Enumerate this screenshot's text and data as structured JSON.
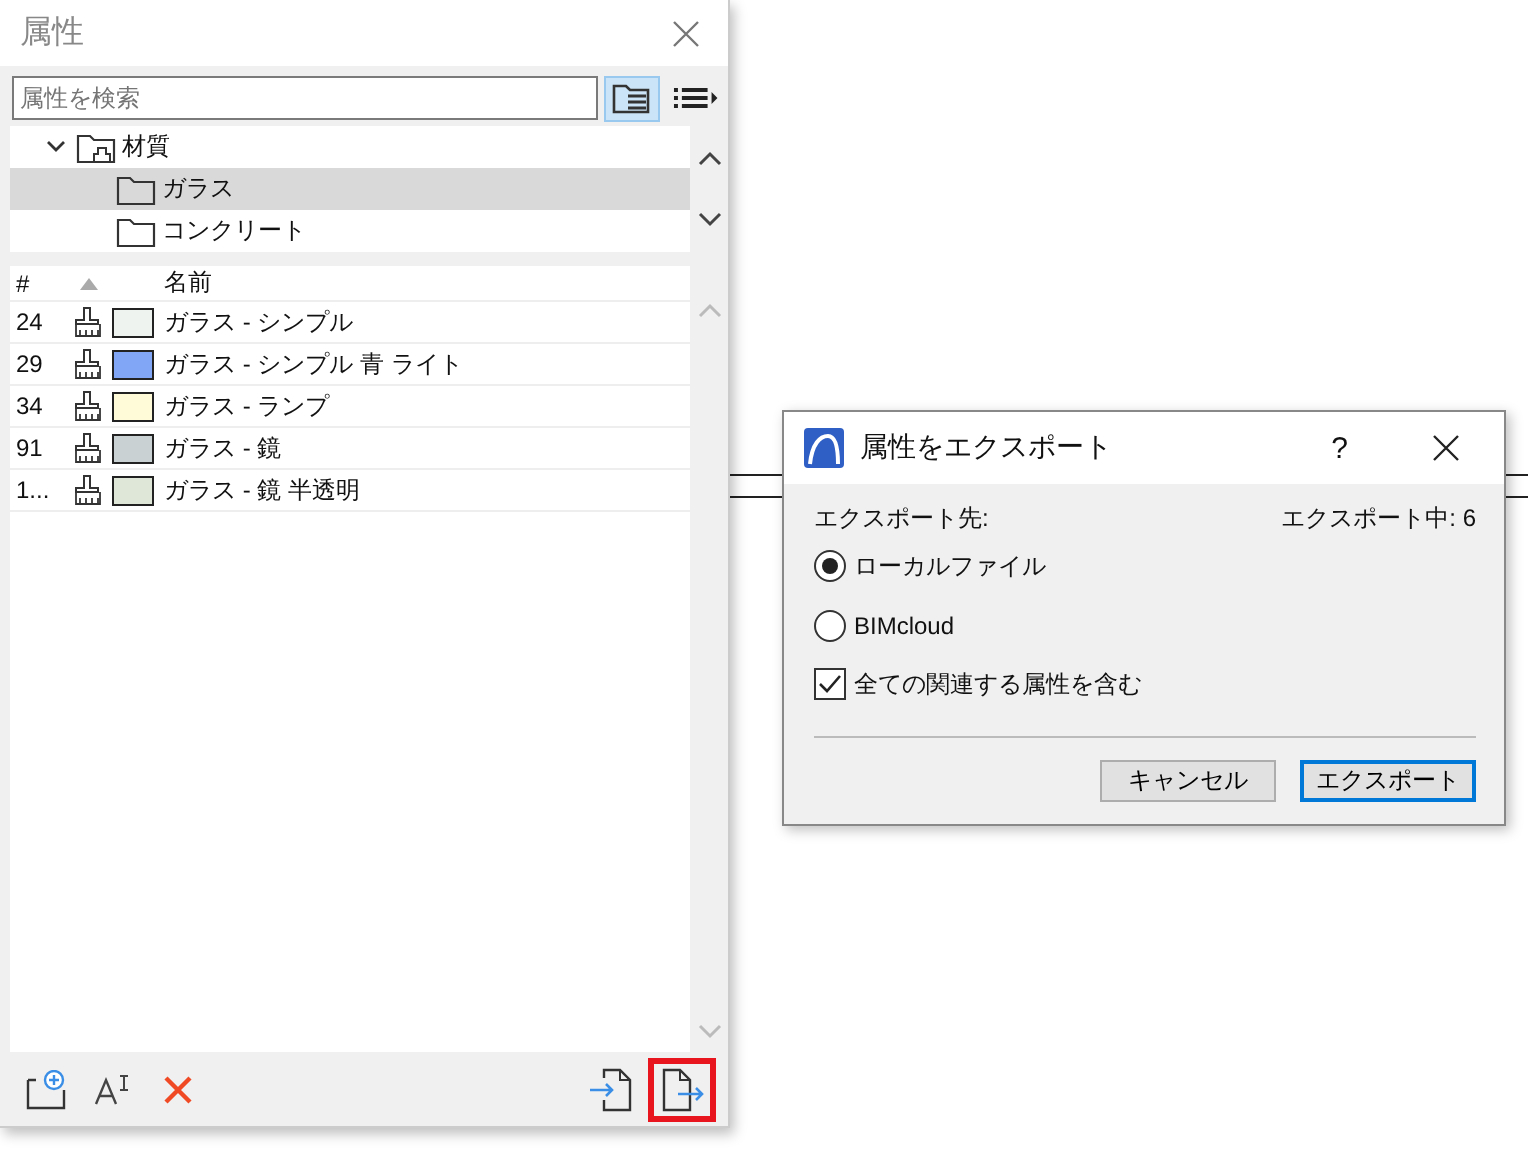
{
  "panel": {
    "title": "属性",
    "search": {
      "placeholder": "属性を検索"
    },
    "tree": [
      {
        "label": "材質",
        "expanded": true,
        "selected": false,
        "children": [
          {
            "label": "ガラス",
            "selected": true
          },
          {
            "label": "コンクリート",
            "selected": false
          }
        ]
      }
    ],
    "table": {
      "columns": [
        "#",
        "名前"
      ],
      "rows": [
        {
          "number": "24",
          "name": "ガラス - シンプル",
          "color": "#eef3ef"
        },
        {
          "number": "29",
          "name": "ガラス - シンプル 青 ライト",
          "color": "#80a6f5"
        },
        {
          "number": "34",
          "name": "ガラス - ランプ",
          "color": "#fffbd9"
        },
        {
          "number": "91",
          "name": "ガラス - 鏡",
          "color": "#c9d1d3"
        },
        {
          "number": "1...",
          "name": "ガラス - 鏡 半透明",
          "color": "#dfe8d8"
        }
      ]
    },
    "export_button": {
      "highlighted": true
    }
  },
  "dialog": {
    "title": "属性をエクスポート",
    "help": "?",
    "destination_label": "エクスポート先:",
    "count": "エクスポート中: 6",
    "options": [
      {
        "label": "ローカルファイル",
        "selected": true
      },
      {
        "label": "BIMcloud",
        "selected": false
      }
    ],
    "checkbox": {
      "label": "全ての関連する属性を含む",
      "checked": true
    },
    "buttons": [
      {
        "label": "キャンセル",
        "default": false
      },
      {
        "label": "エクスポート",
        "default": true
      }
    ]
  }
}
